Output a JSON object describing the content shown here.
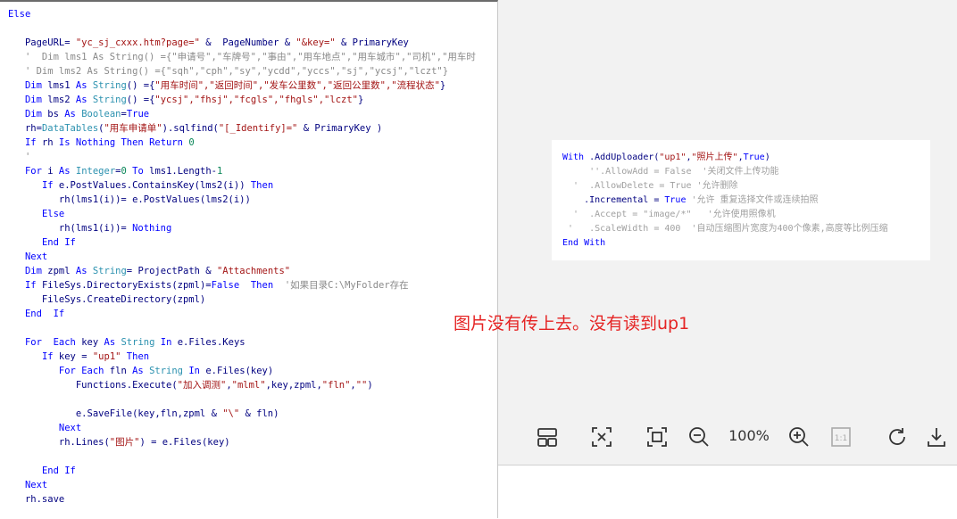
{
  "code": {
    "lines": [
      [
        {
          "t": "Else",
          "c": "kw"
        }
      ],
      [],
      [
        {
          "t": "   PageURL= ",
          "c": "tx"
        },
        {
          "t": "\"yc_sj_cxxx.htm?page=\"",
          "c": "st"
        },
        {
          "t": " &  PageNumber & ",
          "c": "tx"
        },
        {
          "t": "\"&key=\"",
          "c": "st"
        },
        {
          "t": " & PrimaryKey",
          "c": "tx"
        }
      ],
      [
        {
          "t": "   '  Dim lms1 As String() ={\"申请号\",\"车牌号\",\"事由\",\"用车地点\",\"用车城市\",\"司机\",\"用车时",
          "c": "cm"
        }
      ],
      [
        {
          "t": "   ' Dim lms2 As String() ={\"sqh\",\"cph\",\"sy\",\"ycdd\",\"yccs\",\"sj\",\"ycsj\",\"lczt\"}",
          "c": "cm"
        }
      ],
      [
        {
          "t": "   ",
          "c": "tx"
        },
        {
          "t": "Dim",
          "c": "kw"
        },
        {
          "t": " lms1 ",
          "c": "tx"
        },
        {
          "t": "As",
          "c": "kw"
        },
        {
          "t": " ",
          "c": "tx"
        },
        {
          "t": "String",
          "c": "ty"
        },
        {
          "t": "() ={",
          "c": "tx"
        },
        {
          "t": "\"用车时间\",\"返回时间\",\"发车公里数\",\"返回公里数\",\"流程状态\"",
          "c": "st"
        },
        {
          "t": "}",
          "c": "tx"
        }
      ],
      [
        {
          "t": "   ",
          "c": "tx"
        },
        {
          "t": "Dim",
          "c": "kw"
        },
        {
          "t": " lms2 ",
          "c": "tx"
        },
        {
          "t": "As",
          "c": "kw"
        },
        {
          "t": " ",
          "c": "tx"
        },
        {
          "t": "String",
          "c": "ty"
        },
        {
          "t": "() ={",
          "c": "tx"
        },
        {
          "t": "\"ycsj\",\"fhsj\",\"fcgls\",\"fhgls\",\"lczt\"",
          "c": "st"
        },
        {
          "t": "}",
          "c": "tx"
        }
      ],
      [
        {
          "t": "   ",
          "c": "tx"
        },
        {
          "t": "Dim",
          "c": "kw"
        },
        {
          "t": " bs ",
          "c": "tx"
        },
        {
          "t": "As",
          "c": "kw"
        },
        {
          "t": " ",
          "c": "tx"
        },
        {
          "t": "Boolean",
          "c": "ty"
        },
        {
          "t": "=",
          "c": "tx"
        },
        {
          "t": "True",
          "c": "kw"
        }
      ],
      [
        {
          "t": "   rh=",
          "c": "tx"
        },
        {
          "t": "DataTables",
          "c": "ty"
        },
        {
          "t": "(",
          "c": "tx"
        },
        {
          "t": "\"用车申请单\"",
          "c": "st"
        },
        {
          "t": ").sqlfind(",
          "c": "tx"
        },
        {
          "t": "\"[_Identify]=\"",
          "c": "st"
        },
        {
          "t": " & PrimaryKey )",
          "c": "tx"
        }
      ],
      [
        {
          "t": "   ",
          "c": "tx"
        },
        {
          "t": "If",
          "c": "kw"
        },
        {
          "t": " rh ",
          "c": "tx"
        },
        {
          "t": "Is Nothing Then Return",
          "c": "kw"
        },
        {
          "t": " ",
          "c": "tx"
        },
        {
          "t": "0",
          "c": "nm"
        }
      ],
      [
        {
          "t": "   '",
          "c": "cm"
        }
      ],
      [
        {
          "t": "   ",
          "c": "tx"
        },
        {
          "t": "For",
          "c": "kw"
        },
        {
          "t": " i ",
          "c": "tx"
        },
        {
          "t": "As",
          "c": "kw"
        },
        {
          "t": " ",
          "c": "tx"
        },
        {
          "t": "Integer",
          "c": "ty"
        },
        {
          "t": "=",
          "c": "tx"
        },
        {
          "t": "0",
          "c": "nm"
        },
        {
          "t": " ",
          "c": "tx"
        },
        {
          "t": "To",
          "c": "kw"
        },
        {
          "t": " lms1.Length-",
          "c": "tx"
        },
        {
          "t": "1",
          "c": "nm"
        }
      ],
      [
        {
          "t": "      ",
          "c": "tx"
        },
        {
          "t": "If",
          "c": "kw"
        },
        {
          "t": " e.PostValues.ContainsKey(lms2(i)) ",
          "c": "tx"
        },
        {
          "t": "Then",
          "c": "kw"
        }
      ],
      [
        {
          "t": "         rh(lms1(i))= e.PostValues(lms2(i))",
          "c": "tx"
        }
      ],
      [
        {
          "t": "      ",
          "c": "tx"
        },
        {
          "t": "Else",
          "c": "kw"
        }
      ],
      [
        {
          "t": "         rh(lms1(i))= ",
          "c": "tx"
        },
        {
          "t": "Nothing",
          "c": "kw"
        }
      ],
      [
        {
          "t": "      ",
          "c": "tx"
        },
        {
          "t": "End If",
          "c": "kw"
        }
      ],
      [
        {
          "t": "   ",
          "c": "tx"
        },
        {
          "t": "Next",
          "c": "kw"
        }
      ],
      [
        {
          "t": "   ",
          "c": "tx"
        },
        {
          "t": "Dim",
          "c": "kw"
        },
        {
          "t": " zpml ",
          "c": "tx"
        },
        {
          "t": "As",
          "c": "kw"
        },
        {
          "t": " ",
          "c": "tx"
        },
        {
          "t": "String",
          "c": "ty"
        },
        {
          "t": "= ProjectPath & ",
          "c": "tx"
        },
        {
          "t": "\"Attachments\"",
          "c": "st"
        }
      ],
      [
        {
          "t": "   ",
          "c": "tx"
        },
        {
          "t": "If",
          "c": "kw"
        },
        {
          "t": " FileSys.DirectoryExists(zpml)=",
          "c": "tx"
        },
        {
          "t": "False",
          "c": "kw"
        },
        {
          "t": "  ",
          "c": "tx"
        },
        {
          "t": "Then",
          "c": "kw"
        },
        {
          "t": "  ",
          "c": "tx"
        },
        {
          "t": "'如果目录C:\\MyFolder存在",
          "c": "cm"
        }
      ],
      [
        {
          "t": "      FileSys.CreateDirectory(zpml)",
          "c": "tx"
        }
      ],
      [
        {
          "t": "   ",
          "c": "tx"
        },
        {
          "t": "End  If",
          "c": "kw"
        }
      ],
      [],
      [
        {
          "t": "   ",
          "c": "tx"
        },
        {
          "t": "For",
          "c": "kw"
        },
        {
          "t": "  ",
          "c": "tx"
        },
        {
          "t": "Each",
          "c": "kw"
        },
        {
          "t": " key ",
          "c": "tx"
        },
        {
          "t": "As",
          "c": "kw"
        },
        {
          "t": " ",
          "c": "tx"
        },
        {
          "t": "String",
          "c": "ty"
        },
        {
          "t": " ",
          "c": "tx"
        },
        {
          "t": "In",
          "c": "kw"
        },
        {
          "t": " e.Files.Keys",
          "c": "tx"
        }
      ],
      [
        {
          "t": "      ",
          "c": "tx"
        },
        {
          "t": "If",
          "c": "kw"
        },
        {
          "t": " key = ",
          "c": "tx"
        },
        {
          "t": "\"up1\"",
          "c": "st"
        },
        {
          "t": " ",
          "c": "tx"
        },
        {
          "t": "Then",
          "c": "kw"
        }
      ],
      [
        {
          "t": "         ",
          "c": "tx"
        },
        {
          "t": "For Each",
          "c": "kw"
        },
        {
          "t": " fln ",
          "c": "tx"
        },
        {
          "t": "As",
          "c": "kw"
        },
        {
          "t": " ",
          "c": "tx"
        },
        {
          "t": "String",
          "c": "ty"
        },
        {
          "t": " ",
          "c": "tx"
        },
        {
          "t": "In",
          "c": "kw"
        },
        {
          "t": " e.Files(key)",
          "c": "tx"
        }
      ],
      [
        {
          "t": "            Functions.Execute(",
          "c": "tx"
        },
        {
          "t": "\"加入调测\"",
          "c": "st"
        },
        {
          "t": ",",
          "c": "tx"
        },
        {
          "t": "\"mlml\"",
          "c": "st"
        },
        {
          "t": ",key,zpml,",
          "c": "tx"
        },
        {
          "t": "\"fln\"",
          "c": "st"
        },
        {
          "t": ",",
          "c": "tx"
        },
        {
          "t": "\"\"",
          "c": "st"
        },
        {
          "t": ")",
          "c": "tx"
        }
      ],
      [],
      [
        {
          "t": "            e.SaveFile(key,fln,zpml & ",
          "c": "tx"
        },
        {
          "t": "\"\\\"",
          "c": "st"
        },
        {
          "t": " & fln)",
          "c": "tx"
        }
      ],
      [
        {
          "t": "         ",
          "c": "tx"
        },
        {
          "t": "Next",
          "c": "kw"
        }
      ],
      [
        {
          "t": "         rh.Lines(",
          "c": "tx"
        },
        {
          "t": "\"图片\"",
          "c": "st"
        },
        {
          "t": ") = e.Files(key)",
          "c": "tx"
        }
      ],
      [],
      [
        {
          "t": "      ",
          "c": "tx"
        },
        {
          "t": "End If",
          "c": "kw"
        }
      ],
      [
        {
          "t": "   ",
          "c": "tx"
        },
        {
          "t": "Next",
          "c": "kw"
        }
      ],
      [
        {
          "t": "   rh.save",
          "c": "tx"
        }
      ]
    ]
  },
  "snippet": {
    "lines": [
      [
        {
          "t": "With",
          "c": "kw"
        },
        {
          "t": " .AddUploader(",
          "c": "tx"
        },
        {
          "t": "\"up1\"",
          "c": "st"
        },
        {
          "t": ",",
          "c": "tx"
        },
        {
          "t": "\"照片上传\"",
          "c": "st"
        },
        {
          "t": ",",
          "c": "tx"
        },
        {
          "t": "True",
          "c": "kw"
        },
        {
          "t": ")",
          "c": "tx"
        }
      ],
      [
        {
          "t": "     ''.AllowAdd = False  '关闭文件上传功能",
          "c": "cm"
        }
      ],
      [
        {
          "t": "  '  .AllowDelete = True '允许删除",
          "c": "cm"
        }
      ],
      [
        {
          "t": "    .Incremental = ",
          "c": "tx"
        },
        {
          "t": "True",
          "c": "kw"
        },
        {
          "t": " ",
          "c": "tx"
        },
        {
          "t": "'允许 重复选择文件或连续拍照",
          "c": "cm"
        }
      ],
      [
        {
          "t": "  '  .Accept = \"image/*\"   '允许使用照像机",
          "c": "cm"
        }
      ],
      [
        {
          "t": " '   .ScaleWidth = 400  '自动压缩图片宽度为400个像素,高度等比例压缩",
          "c": "cm"
        }
      ],
      [
        {
          "t": "End With",
          "c": "kw"
        }
      ]
    ]
  },
  "annotation": "图片没有传上去。没有读到up1",
  "viewer": {
    "zoom_label": "100%",
    "actual_size_label": "1:1"
  }
}
